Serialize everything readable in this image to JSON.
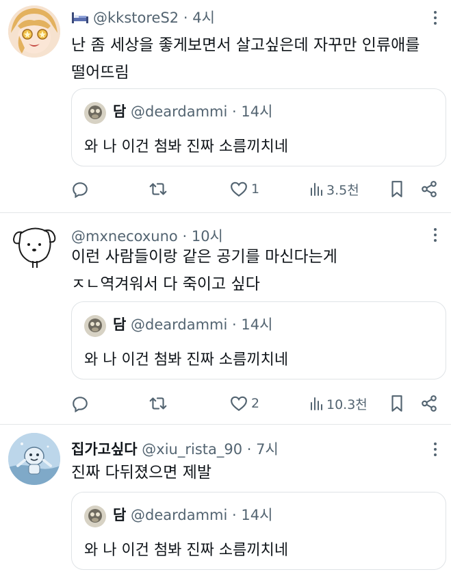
{
  "tweets": [
    {
      "name": "",
      "handle_prefix": "🛏",
      "handle": "@kkstoreS2",
      "time": "4시",
      "text_lines": [
        "난 좀 세상을 좋게보면서 살고싶은데 자꾸만 인류애를",
        "떨어뜨림"
      ],
      "quote": {
        "name": "담",
        "handle": "@deardammi",
        "time": "14시",
        "text": "와 나 이건 첨봐 진짜 소름끼치네"
      },
      "likes": "1",
      "views": "3.5천",
      "avatar_icon": "anime-girl-avatar-icon"
    },
    {
      "name": "",
      "handle": "@mxnecoxuno",
      "time": "10시",
      "text_lines": [
        "이런 사람들이랑 같은 공기를 마신다는게",
        "ㅈㄴ역겨워서 다 죽이고 싶다"
      ],
      "quote": {
        "name": "담",
        "handle": "@deardammi",
        "time": "14시",
        "text": "와 나 이건 첨봐 진짜 소름끼치네"
      },
      "likes": "2",
      "views": "10.3천",
      "avatar_icon": "doodle-dog-avatar-icon"
    },
    {
      "name": "집가고싶다",
      "handle": "@xiu_rista_90",
      "time": "7시",
      "text_lines": [
        "진짜 다뒤졌으면 제발"
      ],
      "quote": {
        "name": "담",
        "handle": "@deardammi",
        "time": "14시",
        "text": "와 나 이건 첨봐 진짜 소름끼치네"
      },
      "avatar_icon": "underwater-character-avatar-icon"
    }
  ],
  "separator": "·",
  "colors": {
    "secondary_text": "#536471",
    "primary_text": "#0f1419",
    "border": "#dfe3e6"
  }
}
